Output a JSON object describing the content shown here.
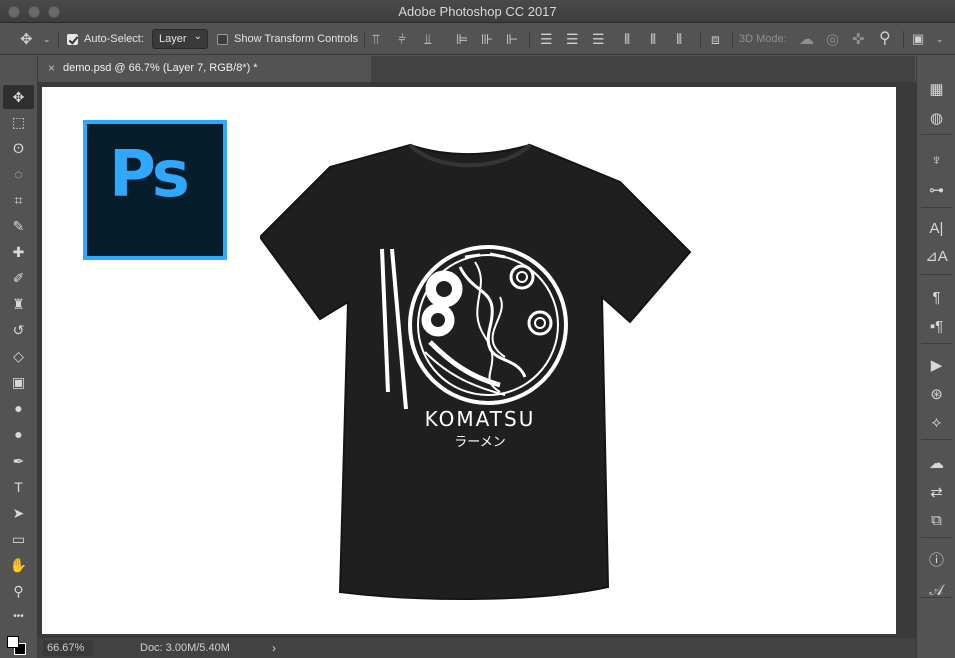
{
  "app": {
    "title": "Adobe Photoshop CC 2017"
  },
  "options": {
    "auto_select_label": "Auto-Select:",
    "auto_select_checked": true,
    "auto_select_value": "Layer",
    "show_transform_label": "Show Transform Controls",
    "show_transform_checked": false,
    "mode_3d_label": "3D Mode:"
  },
  "document": {
    "tab_title": "demo.psd @ 66.7% (Layer 7, RGB/8*) *",
    "close_glyph": "×"
  },
  "canvas": {
    "logo_text": "Ps",
    "shirt_brand": "KOMATSU",
    "shirt_subtitle": "ラーメン"
  },
  "status": {
    "zoom": "66.67%",
    "doc_info": "Doc: 3.00M/5.40M",
    "arrow": "›"
  },
  "colors": {
    "ps_blue": "#31a8ff",
    "ps_dark": "#061e2c",
    "ui_gray": "#535353",
    "shirt_black": "#1f1f1f"
  },
  "tools": [
    {
      "name": "move-tool",
      "glyph": "✥"
    },
    {
      "name": "marquee-tool",
      "glyph": "⬚"
    },
    {
      "name": "lasso-tool",
      "glyph": "ʘ"
    },
    {
      "name": "quick-select-tool",
      "glyph": "◌"
    },
    {
      "name": "crop-tool",
      "glyph": "⌗"
    },
    {
      "name": "eyedropper-tool",
      "glyph": "✎"
    },
    {
      "name": "healing-brush-tool",
      "glyph": "✚"
    },
    {
      "name": "brush-tool",
      "glyph": "✐"
    },
    {
      "name": "clone-stamp-tool",
      "glyph": "♜"
    },
    {
      "name": "history-brush-tool",
      "glyph": "↺"
    },
    {
      "name": "eraser-tool",
      "glyph": "◇"
    },
    {
      "name": "gradient-tool",
      "glyph": "▣"
    },
    {
      "name": "blur-tool",
      "glyph": "●"
    },
    {
      "name": "dodge-tool",
      "glyph": "●"
    },
    {
      "name": "pen-tool",
      "glyph": "✒"
    },
    {
      "name": "type-tool",
      "glyph": "T"
    },
    {
      "name": "path-select-tool",
      "glyph": "➤"
    },
    {
      "name": "rectangle-tool",
      "glyph": "▭"
    },
    {
      "name": "hand-tool",
      "glyph": "✋"
    },
    {
      "name": "zoom-tool",
      "glyph": "⚲"
    },
    {
      "name": "more-tools",
      "glyph": "•••"
    }
  ],
  "right_panel": [
    {
      "name": "swatches-panel-icon",
      "glyph": "▦"
    },
    {
      "name": "color-panel-icon",
      "glyph": "◍"
    },
    {
      "name": "brushes-panel-icon",
      "glyph": "♆"
    },
    {
      "name": "adjustments-panel-icon",
      "glyph": "⊶"
    },
    {
      "name": "character-panel-icon",
      "glyph": "A|"
    },
    {
      "name": "character-styles-panel-icon",
      "glyph": "⊿A"
    },
    {
      "name": "paragraph-panel-icon",
      "glyph": "¶"
    },
    {
      "name": "paragraph-styles-panel-icon",
      "glyph": "▪¶"
    },
    {
      "name": "actions-panel-icon",
      "glyph": "▶"
    },
    {
      "name": "channels-panel-icon",
      "glyph": "⊛"
    },
    {
      "name": "paths-panel-icon",
      "glyph": "⟡"
    },
    {
      "name": "libraries-panel-icon",
      "glyph": "☁"
    },
    {
      "name": "history-panel-icon",
      "glyph": "⇄"
    },
    {
      "name": "layer-comps-panel-icon",
      "glyph": "⧉"
    },
    {
      "name": "info-panel-icon",
      "glyph": "ⓘ"
    },
    {
      "name": "glyphs-panel-icon",
      "glyph": "𝒜"
    }
  ]
}
